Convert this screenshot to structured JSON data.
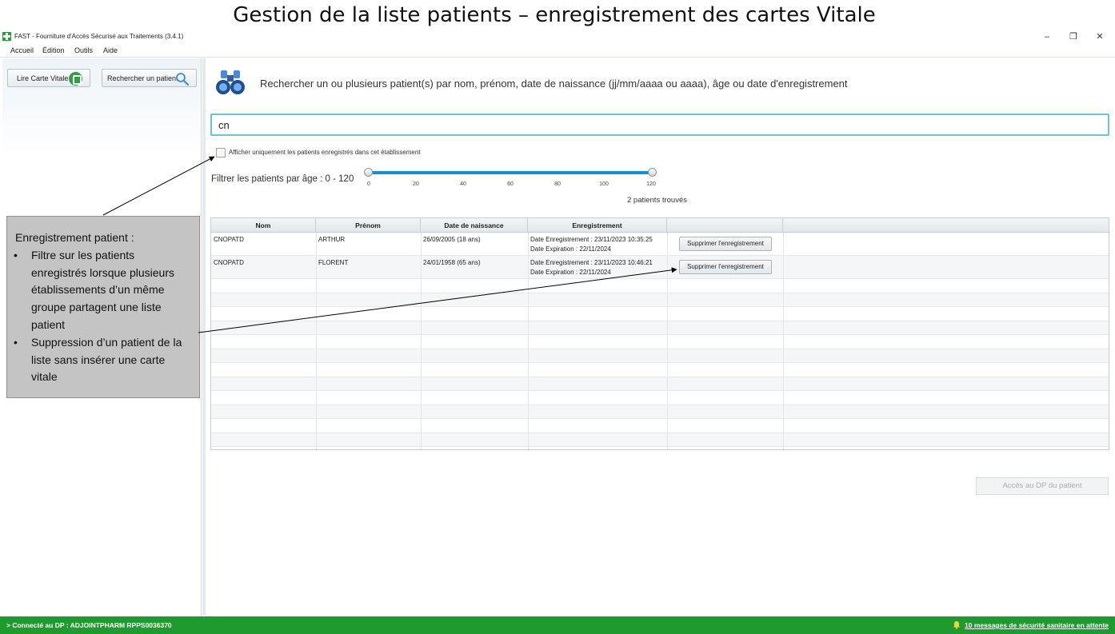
{
  "slide": {
    "title": "Gestion de la liste patients – enregistrement des cartes Vitale"
  },
  "window": {
    "title": "FAST - Fourniture d'Accès Sécurisé aux Traitements (3.4.1)",
    "minimize": "–",
    "restore": "❐",
    "close": "✕"
  },
  "menu": [
    "Accueil",
    "Édition",
    "Outils",
    "Aide"
  ],
  "sidebar": {
    "read_card_label": "Lire Carte Vitale",
    "search_patient_label": "Rechercher un patient"
  },
  "search": {
    "hint": "Rechercher un ou plusieurs patient(s) par nom, prénom, date de naissance (jj/mm/aaaa ou aaaa), âge ou date d'enregistrement",
    "value": "cn"
  },
  "filter": {
    "only_registered_label": "Afficher uniquement les patients enregistrés dans cet établissement",
    "only_registered_checked": false,
    "age_label": "Filtrer les patients par âge : 0 - 120",
    "age_min": 0,
    "age_max": 120,
    "ticks": [
      "0",
      "20",
      "40",
      "60",
      "80",
      "100",
      "120"
    ]
  },
  "results": {
    "count_text": "2 patients trouvés"
  },
  "table": {
    "headers": [
      "Nom",
      "Prénom",
      "Date de naissance",
      "Enregistrement"
    ],
    "rows": [
      {
        "nom": "CNOPATD",
        "prenom": "ARTHUR",
        "naissance": "26/09/2005 (18 ans)",
        "enregistrement": "Date Enregistrement : 23/11/2023 10:35:25",
        "expiration": "Date Expiration : 22/11/2024",
        "action": "Supprimer l'enregistrement"
      },
      {
        "nom": "CNOPATD",
        "prenom": "FLORENT",
        "naissance": "24/01/1958 (65 ans)",
        "enregistrement": "Date Enregistrement : 23/11/2023 10:46:21",
        "expiration": "Date Expiration : 22/11/2024",
        "action": "Supprimer l'enregistrement"
      }
    ]
  },
  "dp_button": {
    "label": "Accès au DP du patient",
    "enabled": false
  },
  "callout": {
    "title": "Enregistrement patient :",
    "bullets": [
      "Filtre sur les patients enregistrés lorsque plusieurs établissements d’un même groupe partagent une liste patient",
      "Suppression d’un patient de la liste sans insérer une carte vitale"
    ]
  },
  "status": {
    "left": "> Connecté au DP : ADJOINTPHARM RPPS0036370",
    "right": "10 messages de sécurité sanitaire en attente",
    "bar_color": "#1f9a2e"
  },
  "icons": {
    "app": "green-cross-icon",
    "card": "vitale-card-icon",
    "search": "magnifier-icon",
    "binoculars": "binoculars-icon",
    "bell": "bell-icon"
  }
}
